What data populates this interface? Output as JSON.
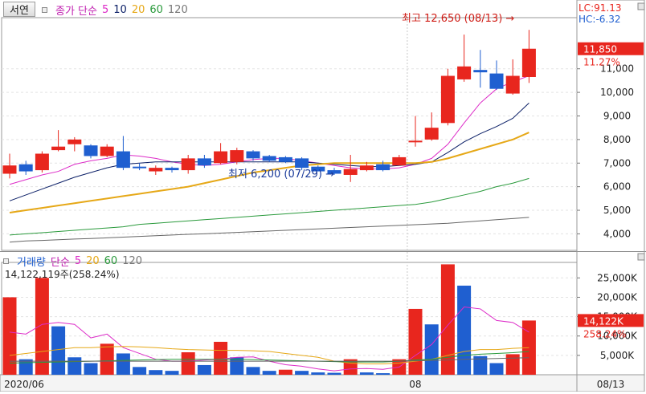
{
  "header": {
    "stock_button": "서연",
    "legend_ma_label": "종가 단순",
    "ma_periods": [
      "5",
      "10",
      "20",
      "60",
      "120"
    ],
    "lc_label": "LC:91.13",
    "hc_label": "HC:-6.32"
  },
  "volume_header": {
    "label": "거래량",
    "ma_label": "단순",
    "ma_periods": [
      "5",
      "20",
      "60",
      "120"
    ],
    "current": "14,122,119주(258.24%)"
  },
  "annotations": {
    "high": "최고 12,650 (08/13) →",
    "low": "최저 6,200 (07/29) →"
  },
  "price_badge": {
    "price": "11,850",
    "change": "11.27%"
  },
  "volume_badge": {
    "value": "14,122K",
    "change": "258.24%"
  },
  "colors": {
    "up": "#e8261e",
    "down": "#1f5fd0",
    "ma5": "#dd2cc8",
    "ma10": "#0a1e66",
    "ma20": "#e6a817",
    "ma60": "#2a9a3c",
    "ma120": "#666666"
  },
  "chart_data": [
    {
      "type": "candlestick",
      "title": "",
      "xlabel": "",
      "ylabel": "",
      "ylim": [
        3300,
        13100
      ],
      "y_ticks": [
        "4,000",
        "5,000",
        "6,000",
        "7,000",
        "8,000",
        "9,000",
        "10,000",
        "11,000"
      ],
      "x_tick_labels": [
        "2020/06",
        "08",
        "08/13"
      ],
      "grid": true,
      "candles": [
        {
          "o": 6550,
          "h": 7400,
          "l": 6350,
          "c": 6900
        },
        {
          "o": 6950,
          "h": 7100,
          "l": 6500,
          "c": 6650
        },
        {
          "o": 6700,
          "h": 7500,
          "l": 6600,
          "c": 7400
        },
        {
          "o": 7550,
          "h": 8400,
          "l": 7500,
          "c": 7700
        },
        {
          "o": 7800,
          "h": 8100,
          "l": 7500,
          "c": 8000
        },
        {
          "o": 7750,
          "h": 7800,
          "l": 7200,
          "c": 7300
        },
        {
          "o": 7300,
          "h": 7800,
          "l": 7250,
          "c": 7700
        },
        {
          "o": 7500,
          "h": 8150,
          "l": 6700,
          "c": 6800
        },
        {
          "o": 6850,
          "h": 7000,
          "l": 6700,
          "c": 6800
        },
        {
          "o": 6650,
          "h": 6900,
          "l": 6500,
          "c": 6800
        },
        {
          "o": 6800,
          "h": 6850,
          "l": 6600,
          "c": 6700
        },
        {
          "o": 6700,
          "h": 7350,
          "l": 6550,
          "c": 7200
        },
        {
          "o": 7200,
          "h": 7350,
          "l": 6800,
          "c": 6900
        },
        {
          "o": 7000,
          "h": 7850,
          "l": 6950,
          "c": 7500
        },
        {
          "o": 7050,
          "h": 7650,
          "l": 6950,
          "c": 7550
        },
        {
          "o": 7500,
          "h": 7550,
          "l": 7100,
          "c": 7200
        },
        {
          "o": 7300,
          "h": 7350,
          "l": 7050,
          "c": 7100
        },
        {
          "o": 7250,
          "h": 7300,
          "l": 7000,
          "c": 7050
        },
        {
          "o": 7200,
          "h": 7250,
          "l": 6700,
          "c": 6800
        },
        {
          "o": 6850,
          "h": 6900,
          "l": 6650,
          "c": 6650
        },
        {
          "o": 6700,
          "h": 6800,
          "l": 6500,
          "c": 6550
        },
        {
          "o": 6500,
          "h": 7350,
          "l": 6200,
          "c": 6750
        },
        {
          "o": 6700,
          "h": 7050,
          "l": 6650,
          "c": 6900
        },
        {
          "o": 6950,
          "h": 7100,
          "l": 6650,
          "c": 6700
        },
        {
          "o": 6900,
          "h": 7350,
          "l": 6900,
          "c": 7250
        },
        {
          "o": 7950,
          "h": 9000,
          "l": 7700,
          "c": 7950
        },
        {
          "o": 8000,
          "h": 9150,
          "l": 7950,
          "c": 8500
        },
        {
          "o": 8700,
          "h": 11000,
          "l": 8600,
          "c": 10700
        },
        {
          "o": 10550,
          "h": 12450,
          "l": 10450,
          "c": 11100
        },
        {
          "o": 10950,
          "h": 11800,
          "l": 10200,
          "c": 10850
        },
        {
          "o": 10800,
          "h": 11350,
          "l": 10100,
          "c": 10150
        },
        {
          "o": 9950,
          "h": 11400,
          "l": 9900,
          "c": 10700
        },
        {
          "o": 10650,
          "h": 12650,
          "l": 10400,
          "c": 11850
        }
      ],
      "series": [
        {
          "name": "5",
          "values": [
            6100,
            6300,
            6500,
            6650,
            6950,
            7100,
            7200,
            7350,
            7300,
            7200,
            7050,
            6950,
            6900,
            6950,
            7050,
            7150,
            7200,
            7200,
            7100,
            7000,
            6900,
            6800,
            6750,
            6750,
            6800,
            6950,
            7200,
            7800,
            8700,
            9550,
            10150,
            10450,
            10700
          ]
        },
        {
          "name": "10",
          "values": [
            5400,
            5650,
            5900,
            6150,
            6400,
            6600,
            6800,
            6950,
            7000,
            7050,
            7050,
            7050,
            7050,
            7050,
            7050,
            7050,
            7050,
            7050,
            7050,
            7000,
            6950,
            6900,
            6850,
            6850,
            6900,
            6950,
            7050,
            7450,
            7900,
            8250,
            8550,
            8900,
            9550
          ]
        },
        {
          "name": "20",
          "values": [
            4900,
            5000,
            5100,
            5200,
            5300,
            5400,
            5500,
            5600,
            5700,
            5800,
            5900,
            6000,
            6150,
            6300,
            6450,
            6600,
            6700,
            6800,
            6900,
            6950,
            7000,
            7000,
            7000,
            7000,
            7000,
            7000,
            7050,
            7200,
            7400,
            7600,
            7800,
            8000,
            8300
          ]
        },
        {
          "name": "60",
          "values": [
            3950,
            4000,
            4050,
            4100,
            4150,
            4200,
            4250,
            4300,
            4400,
            4450,
            4500,
            4550,
            4600,
            4650,
            4700,
            4750,
            4800,
            4850,
            4900,
            4950,
            5000,
            5050,
            5100,
            5150,
            5200,
            5250,
            5350,
            5500,
            5650,
            5800,
            6000,
            6150,
            6350
          ]
        },
        {
          "name": "120",
          "values": [
            3650,
            3700,
            3720,
            3750,
            3780,
            3800,
            3830,
            3860,
            3890,
            3920,
            3950,
            3980,
            4000,
            4030,
            4060,
            4090,
            4120,
            4150,
            4180,
            4210,
            4240,
            4270,
            4300,
            4330,
            4360,
            4390,
            4420,
            4450,
            4500,
            4550,
            4600,
            4650,
            4700
          ]
        }
      ]
    },
    {
      "type": "bar",
      "title": "",
      "xlabel": "",
      "ylabel": "",
      "ylim": [
        0,
        29000
      ],
      "y_ticks": [
        "5,000K",
        "10,000K",
        "15,000K",
        "20,000K",
        "25,000K"
      ],
      "volumes_k": [
        20000,
        4000,
        25000,
        12500,
        4500,
        3000,
        8000,
        5500,
        2000,
        1200,
        1000,
        5800,
        2500,
        8500,
        4500,
        2000,
        1000,
        1300,
        1000,
        600,
        500,
        4000,
        600,
        400,
        4000,
        17000,
        13000,
        28500,
        23000,
        4800,
        3000,
        5300,
        14000
      ],
      "directions": [
        "up",
        "down",
        "up",
        "down",
        "down",
        "down",
        "up",
        "down",
        "down",
        "down",
        "down",
        "up",
        "down",
        "up",
        "down",
        "down",
        "down",
        "up",
        "down",
        "down",
        "down",
        "up",
        "down",
        "down",
        "up",
        "up",
        "down",
        "up",
        "down",
        "down",
        "down",
        "up",
        "up"
      ],
      "series": [
        {
          "name": "5",
          "values": [
            11000,
            10500,
            13000,
            13500,
            13000,
            9500,
            10500,
            7000,
            5500,
            4000,
            3500,
            3500,
            3800,
            4000,
            4500,
            4600,
            3500,
            2600,
            2200,
            1500,
            1000,
            1500,
            1600,
            1400,
            2000,
            5000,
            7800,
            12800,
            17500,
            17000,
            14000,
            13500,
            11000
          ]
        },
        {
          "name": "20",
          "values": [
            5000,
            5500,
            6000,
            6500,
            7000,
            7000,
            7200,
            7300,
            7200,
            7000,
            6700,
            6500,
            6400,
            6300,
            6300,
            6200,
            6000,
            5500,
            5000,
            4500,
            3500,
            3000,
            2800,
            2800,
            3000,
            3500,
            4000,
            5000,
            6000,
            6500,
            6500,
            6800,
            7000
          ]
        },
        {
          "name": "60",
          "values": [
            3000,
            3100,
            3200,
            3300,
            3400,
            3500,
            3600,
            3700,
            3800,
            3900,
            4000,
            4000,
            4000,
            4000,
            4000,
            3900,
            3800,
            3700,
            3600,
            3500,
            3400,
            3300,
            3300,
            3300,
            3500,
            3800,
            4000,
            4500,
            5000,
            5300,
            5500,
            5700,
            6000
          ]
        },
        {
          "name": "120",
          "values": [
            3500,
            3500,
            3500,
            3500,
            3500,
            3500,
            3500,
            3500,
            3500,
            3500,
            3500,
            3500,
            3500,
            3500,
            3500,
            3500,
            3500,
            3500,
            3500,
            3500,
            3500,
            3500,
            3500,
            3500,
            3500,
            3600,
            3700,
            3800,
            4000,
            4100,
            4200,
            4300,
            4400
          ]
        }
      ]
    }
  ]
}
